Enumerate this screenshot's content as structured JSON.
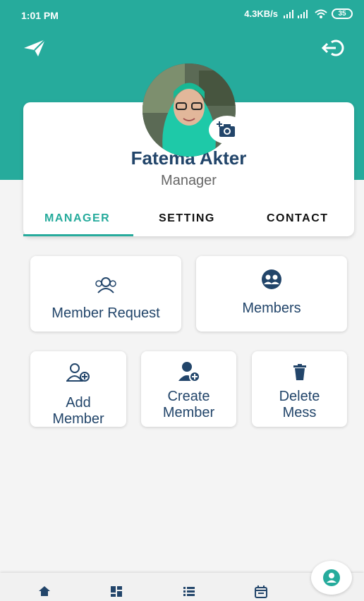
{
  "status_bar": {
    "time": "1:01 PM",
    "speed": "4.3KB/s",
    "battery": "35"
  },
  "header": {
    "send_icon": "send-icon",
    "logout_icon": "logout-icon",
    "color": "#26ab9c"
  },
  "profile": {
    "name": "Fatema Akter",
    "role": "Manager",
    "avatar_icon": "avatar",
    "camera_icon": "add-photo-icon"
  },
  "tabs": [
    {
      "label": "MANAGER",
      "active": true
    },
    {
      "label": "SETTING",
      "active": false
    },
    {
      "label": "CONTACT",
      "active": false
    }
  ],
  "tiles": [
    {
      "label": "Member Request",
      "icon": "member-request-icon"
    },
    {
      "label": "Members",
      "icon": "members-icon"
    },
    {
      "label_line1": "Add",
      "label_line2": "Member",
      "icon": "add-member-icon"
    },
    {
      "label_line1": "Create",
      "label_line2": "Member",
      "icon": "create-member-icon"
    },
    {
      "label_line1": "Delete",
      "label_line2": "Mess",
      "icon": "delete-icon"
    }
  ],
  "bottom_nav": [
    {
      "icon": "home-icon"
    },
    {
      "icon": "dashboard-icon"
    },
    {
      "icon": "list-icon"
    },
    {
      "icon": "calendar-icon"
    },
    {
      "icon": "profile-icon"
    }
  ],
  "colors": {
    "accent": "#26ab9c",
    "text_primary": "#22456a"
  }
}
